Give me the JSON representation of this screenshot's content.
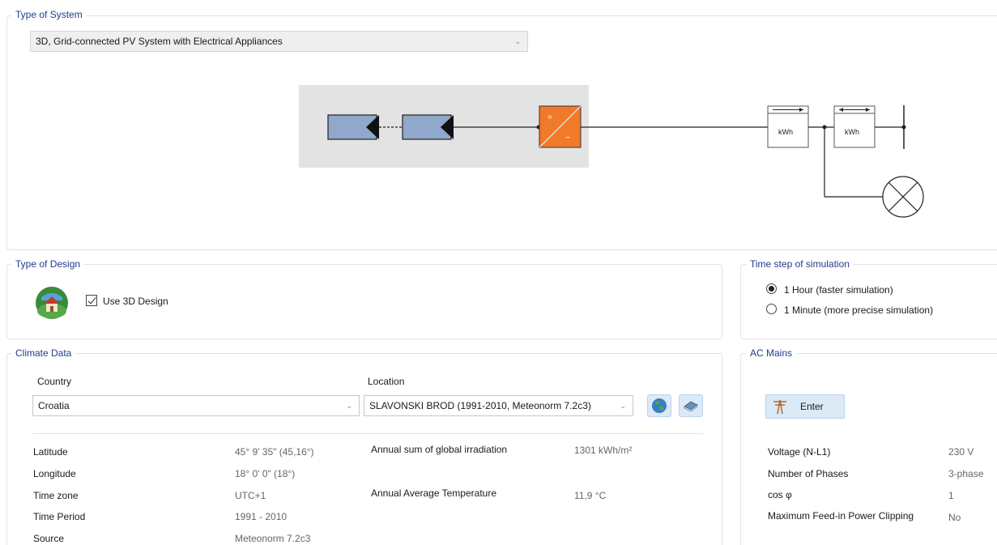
{
  "type_of_system": {
    "title": "Type of System",
    "selected": "3D, Grid-connected PV System with Electrical Appliances",
    "diagram": {
      "meter1_label": "kWh",
      "meter2_label": "kWh",
      "inverter_dc": "=",
      "inverter_ac": "~"
    }
  },
  "type_of_design": {
    "title": "Type of Design",
    "checkbox_label": "Use 3D Design",
    "checked": true,
    "icon": "house-globe-icon"
  },
  "time_step": {
    "title": "Time step of simulation",
    "options": [
      {
        "label": "1 Hour (faster simulation)",
        "selected": true
      },
      {
        "label": "1 Minute (more precise simulation)",
        "selected": false
      }
    ]
  },
  "climate": {
    "title": "Climate Data",
    "country_label": "Country",
    "country_value": "Croatia",
    "location_label": "Location",
    "location_value": "SLAVONSKI BROD (1991-2010, Meteonorm 7.2c3)",
    "rows_left": [
      {
        "label": "Latitude",
        "value": "45° 9' 35\"  (45,16°)"
      },
      {
        "label": "Longitude",
        "value": "18° 0' 0\"  (18°)"
      },
      {
        "label": "Time zone",
        "value": "UTC+1"
      },
      {
        "label": "Time Period",
        "value": "1991 - 2010"
      },
      {
        "label": "Source",
        "value": "Meteonorm 7.2c3"
      }
    ],
    "rows_right": [
      {
        "label": "Annual sum of global irradiation",
        "value": "1301 kWh/m²"
      },
      {
        "label": "Annual Average Temperature",
        "value": "11,9 °C"
      }
    ]
  },
  "ac_mains": {
    "title": "AC Mains",
    "enter_label": "Enter",
    "rows": [
      {
        "label": "Voltage (N-L1)",
        "value": "230 V"
      },
      {
        "label": "Number of Phases",
        "value": "3-phase"
      },
      {
        "label": "cos φ",
        "value": "1"
      },
      {
        "label": "Maximum Feed-in Power Clipping",
        "value": "No"
      }
    ]
  },
  "colors": {
    "title_blue": "#1e3f8a",
    "module_blue": "#8fa8cc",
    "inverter_orange": "#f07a2a",
    "diagram_bg": "#e3e3e3"
  }
}
